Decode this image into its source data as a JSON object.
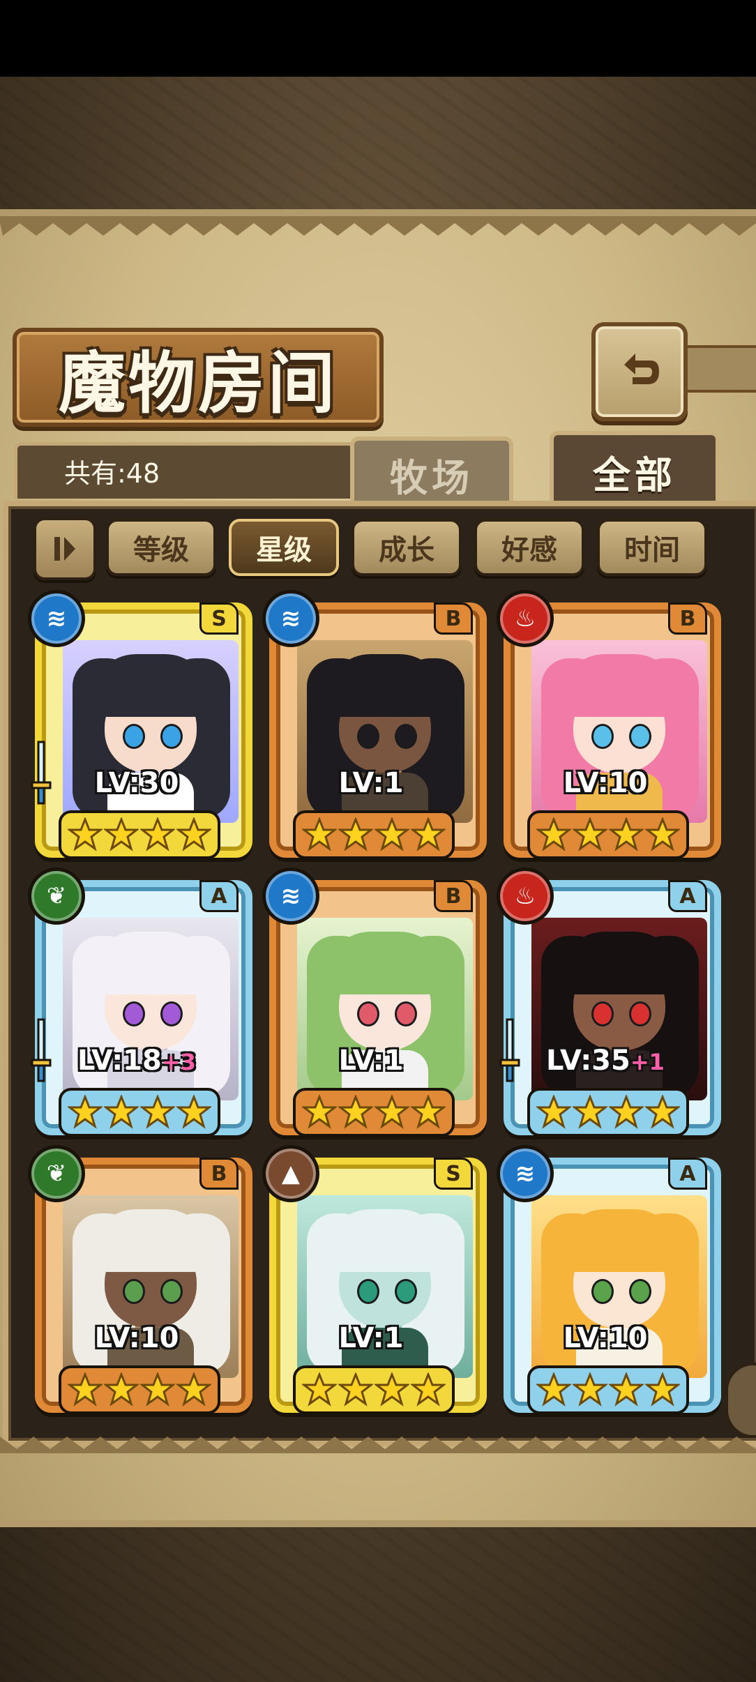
{
  "header": {
    "title": "魔物房间",
    "back_icon": "return-arrow-icon"
  },
  "inventory": {
    "count_label": "共有:48"
  },
  "tabs": [
    {
      "label": "牧场",
      "active": false
    },
    {
      "label": "全部",
      "active": true
    }
  ],
  "filters": {
    "sort_toggle_icon": "sort-toggle-icon",
    "buttons": [
      {
        "label": "等级",
        "active": false
      },
      {
        "label": "星级",
        "active": true
      },
      {
        "label": "成长",
        "active": false
      },
      {
        "label": "好感",
        "active": false
      },
      {
        "label": "时间",
        "active": false
      }
    ]
  },
  "monsters": [
    {
      "element": "water",
      "rank": "S",
      "level": "LV:30",
      "bonus": "",
      "stars": 4,
      "equipped": true
    },
    {
      "element": "water",
      "rank": "B",
      "level": "LV:1",
      "bonus": "",
      "stars": 4,
      "equipped": false
    },
    {
      "element": "fire",
      "rank": "B",
      "level": "LV:10",
      "bonus": "",
      "stars": 4,
      "equipped": false
    },
    {
      "element": "wood",
      "rank": "A",
      "level": "LV:18",
      "bonus": "+3",
      "stars": 4,
      "equipped": true
    },
    {
      "element": "water",
      "rank": "B",
      "level": "LV:1",
      "bonus": "",
      "stars": 4,
      "equipped": false
    },
    {
      "element": "fire",
      "rank": "A",
      "level": "LV:35",
      "bonus": "+1",
      "stars": 4,
      "equipped": true
    },
    {
      "element": "wood",
      "rank": "B",
      "level": "LV:10",
      "bonus": "",
      "stars": 4,
      "equipped": false
    },
    {
      "element": "earth",
      "rank": "S",
      "level": "LV:1",
      "bonus": "",
      "stars": 4,
      "equipped": false
    },
    {
      "element": "water",
      "rank": "A",
      "level": "LV:10",
      "bonus": "",
      "stars": 4,
      "equipped": false
    }
  ],
  "colors": {
    "rank_S": "#f2d83a",
    "rank_A": "#8fd0ea",
    "rank_B": "#e08a37",
    "element_water": "#1f78c8",
    "element_fire": "#c8261d",
    "element_wood": "#2f7a2a",
    "element_earth": "#7a4a2e",
    "star": "#ffd21f"
  }
}
